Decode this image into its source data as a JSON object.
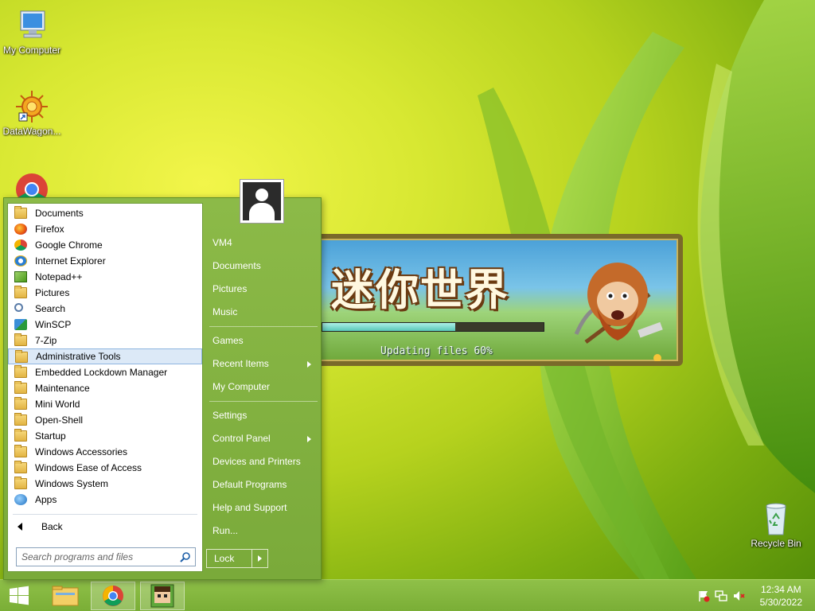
{
  "desktop": {
    "icons": [
      {
        "label": "My Computer",
        "icon": "computer-icon"
      },
      {
        "label": "DataWagon...",
        "icon": "datawagon-icon"
      },
      {
        "label": "",
        "icon": "chrome-icon"
      },
      {
        "label": "Recycle Bin",
        "icon": "recycle-bin-icon"
      }
    ]
  },
  "game": {
    "title_art": "迷你世界",
    "status_text": "Updating files 60%",
    "progress": 0.6
  },
  "start_menu": {
    "programs": [
      {
        "label": "Documents",
        "icon": "folder-icon"
      },
      {
        "label": "Firefox",
        "icon": "firefox-icon"
      },
      {
        "label": "Google Chrome",
        "icon": "chrome-icon"
      },
      {
        "label": "Internet Explorer",
        "icon": "ie-icon"
      },
      {
        "label": "Notepad++",
        "icon": "notepadpp-icon"
      },
      {
        "label": "Pictures",
        "icon": "folder-icon"
      },
      {
        "label": "Search",
        "icon": "search-icon"
      },
      {
        "label": "WinSCP",
        "icon": "winscp-icon"
      },
      {
        "label": "7-Zip",
        "icon": "folder-icon"
      },
      {
        "label": "Administrative Tools",
        "icon": "folder-icon"
      },
      {
        "label": "Embedded Lockdown Manager",
        "icon": "folder-icon"
      },
      {
        "label": "Maintenance",
        "icon": "folder-icon"
      },
      {
        "label": "Mini World",
        "icon": "folder-icon"
      },
      {
        "label": "Open-Shell",
        "icon": "folder-icon"
      },
      {
        "label": "Startup",
        "icon": "folder-icon"
      },
      {
        "label": "Windows Accessories",
        "icon": "folder-icon"
      },
      {
        "label": "Windows Ease of Access",
        "icon": "folder-icon"
      },
      {
        "label": "Windows System",
        "icon": "folder-icon"
      },
      {
        "label": "Apps",
        "icon": "apps-icon"
      }
    ],
    "selected_program": "Administrative Tools",
    "back_label": "Back",
    "search_placeholder": "Search programs and files",
    "right_items": {
      "user": "VM4",
      "documents": "Documents",
      "pictures": "Pictures",
      "music": "Music",
      "games": "Games",
      "recent_items": "Recent Items",
      "my_computer": "My Computer",
      "settings": "Settings",
      "control_panel": "Control Panel",
      "devices_printers": "Devices and Printers",
      "default_programs": "Default Programs",
      "help_support": "Help and Support",
      "run": "Run..."
    },
    "lock_label": "Lock"
  },
  "taskbar": {
    "time": "12:34 AM",
    "date": "5/30/2022"
  },
  "colors": {
    "menu_green": "#7aaa3a",
    "taskbar_green": "#86b840",
    "selection_blue": "#dce9f7"
  }
}
